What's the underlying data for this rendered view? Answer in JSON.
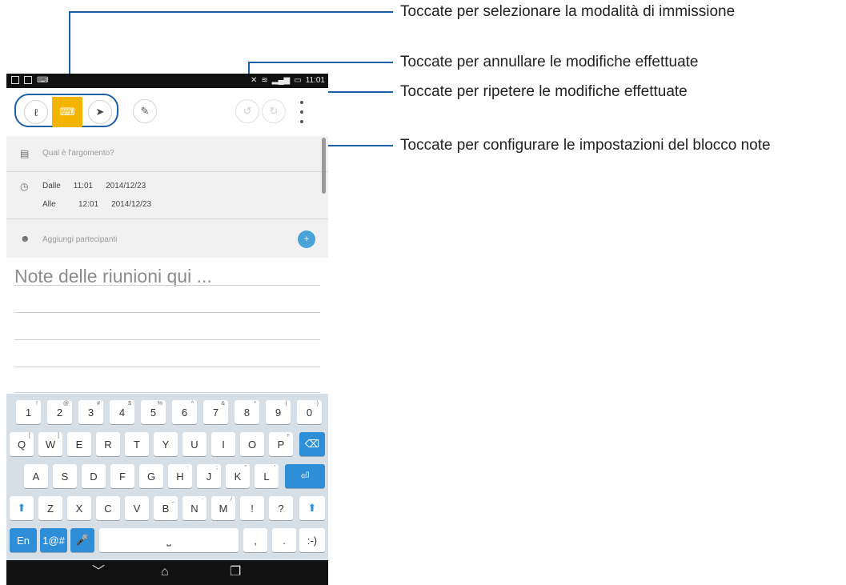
{
  "callouts": {
    "input_mode": "Toccate per selezionare la modalità di immissione",
    "undo": "Toccate per annullare le modifiche effettuate",
    "redo": "Toccate per ripetere le modifiche effettuate",
    "settings": "Toccate per configurare le impostazioni del blocco note"
  },
  "statusbar": {
    "time": "11:01"
  },
  "form": {
    "topic_placeholder": "Qual è l'argomento?",
    "from_label": "Dalle",
    "from_time": "11:01",
    "from_date": "2014/12/23",
    "to_label": "Alle",
    "to_time": "12:01",
    "to_date": "2014/12/23",
    "participants_placeholder": "Aggiungi partecipanti"
  },
  "notes": {
    "placeholder": "Note delle riunioni qui ..."
  },
  "keyboard": {
    "row1": [
      [
        "1",
        "!"
      ],
      [
        "2",
        "@"
      ],
      [
        "3",
        "#"
      ],
      [
        "4",
        "$"
      ],
      [
        "5",
        "%"
      ],
      [
        "6",
        "^"
      ],
      [
        "7",
        "&"
      ],
      [
        "8",
        "*"
      ],
      [
        "9",
        "("
      ],
      [
        "0",
        ")"
      ]
    ],
    "row2": [
      [
        "Q",
        "["
      ],
      [
        "W",
        "]"
      ],
      [
        "E",
        ""
      ],
      [
        "R",
        ""
      ],
      [
        "T",
        ""
      ],
      [
        "Y",
        ""
      ],
      [
        "U",
        ""
      ],
      [
        "I",
        ""
      ],
      [
        "O",
        ""
      ],
      [
        "P",
        "+"
      ]
    ],
    "row3": [
      [
        "A",
        ""
      ],
      [
        "S",
        ""
      ],
      [
        "D",
        ""
      ],
      [
        "F",
        ""
      ],
      [
        "G",
        ""
      ],
      [
        "H",
        ":"
      ],
      [
        "J",
        ";"
      ],
      [
        "K",
        "\""
      ],
      [
        "L",
        "'"
      ]
    ],
    "row4": [
      [
        "Z",
        ""
      ],
      [
        "X",
        ""
      ],
      [
        "C",
        ""
      ],
      [
        "V",
        ""
      ],
      [
        "B",
        "_"
      ],
      [
        "N",
        "-"
      ],
      [
        "M",
        "/"
      ],
      [
        "!",
        ""
      ],
      [
        "?",
        ""
      ]
    ],
    "lang_key": "En",
    "symbols_key": "1@#",
    "comma_key": ",",
    "period_key": ".",
    "smiley_key": ":-)"
  },
  "colors": {
    "accent": "#1d5fa8",
    "mode_active": "#f4b400",
    "keyboard_blue": "#2f8ed8"
  },
  "icons": {
    "mode_handwriting": "handwriting-icon",
    "mode_keyboard": "keyboard-icon",
    "mode_brush": "brush-icon",
    "pen_settings": "pen-settings-icon",
    "undo": "undo-icon",
    "redo": "redo-icon",
    "menu": "overflow-menu-icon"
  }
}
